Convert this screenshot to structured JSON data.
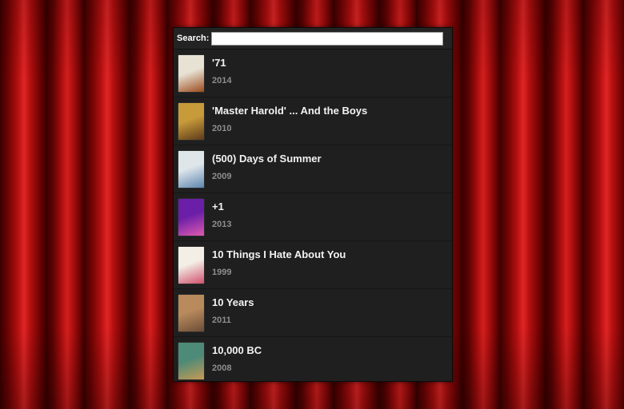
{
  "search": {
    "label": "Search:",
    "value": "",
    "placeholder": ""
  },
  "movies": [
    {
      "title": "'71",
      "year": "2014",
      "poster_colors": [
        "#e8e2d4",
        "#9c4a1c"
      ]
    },
    {
      "title": "'Master Harold' ... And the Boys",
      "year": "2010",
      "poster_colors": [
        "#c79a3a",
        "#5d3a1a"
      ]
    },
    {
      "title": "(500) Days of Summer",
      "year": "2009",
      "poster_colors": [
        "#dfe6ea",
        "#5d86b0"
      ]
    },
    {
      "title": "+1",
      "year": "2013",
      "poster_colors": [
        "#6b1ea8",
        "#e05ab0"
      ]
    },
    {
      "title": "10 Things I Hate About You",
      "year": "1999",
      "poster_colors": [
        "#f3efe6",
        "#d0506e"
      ]
    },
    {
      "title": "10 Years",
      "year": "2011",
      "poster_colors": [
        "#b88a5c",
        "#6b4c38"
      ]
    },
    {
      "title": "10,000 BC",
      "year": "2008",
      "poster_colors": [
        "#4d8a78",
        "#c89a54"
      ]
    }
  ],
  "colors": {
    "panel_bg": "#1e1e1e",
    "title_text": "#f2f2f2",
    "year_text": "#8e8e8e"
  }
}
